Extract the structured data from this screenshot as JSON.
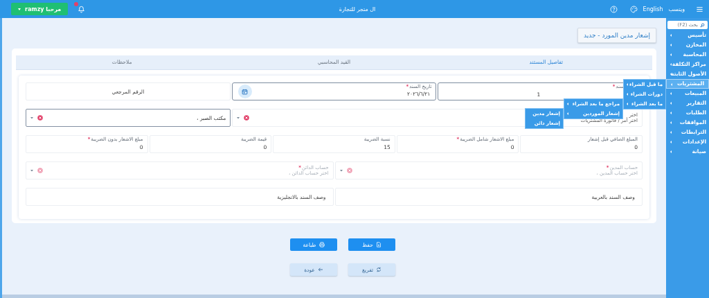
{
  "top_bar": {
    "user_button": "ramzy مرحبا",
    "store_name": "ال متجر للتجارة",
    "language": "English",
    "label": "ويتسب"
  },
  "sidebar": {
    "search_placeholder": "بحث (F2)",
    "items": [
      {
        "label": "تأسيس",
        "selected": false
      },
      {
        "label": "المخازن",
        "selected": false
      },
      {
        "label": "المحاسبة",
        "selected": false
      },
      {
        "label": "مراكز التكلفة",
        "selected": false
      },
      {
        "label": "الأصول الثابتة",
        "selected": false
      },
      {
        "label": "المشتريات",
        "selected": true,
        "children": [
          {
            "label": "ما قبل الشراء"
          },
          {
            "label": "دورات الشراء"
          },
          {
            "label": "ما بعد الشراء",
            "children": [
              {
                "label": "مراجع ما بعد الشراء"
              },
              {
                "label": "إشعار الموردين",
                "children": [
                  {
                    "label": "إشعار مدين"
                  },
                  {
                    "label": "إشعار دائن"
                  }
                ]
              }
            ]
          }
        ]
      },
      {
        "label": "المبيعات",
        "selected": false
      },
      {
        "label": "التقارير",
        "selected": false
      },
      {
        "label": "الطلبات",
        "selected": false
      },
      {
        "label": "الموافقات",
        "selected": false
      },
      {
        "label": "الترابطات",
        "selected": false
      },
      {
        "label": "الإعدادات",
        "selected": false
      },
      {
        "label": "صيانة",
        "selected": false
      }
    ]
  },
  "page_title": "إشعار مدين المورد - جديد",
  "tabs": [
    {
      "label": "تفاصيل المستند",
      "selected": true
    },
    {
      "label": "القيد المحاسبي",
      "selected": false
    },
    {
      "label": "ملاحظات",
      "selected": false
    }
  ],
  "form_rows": [
    [
      {
        "kind": "text",
        "label": "سند",
        "required_mark": "*",
        "value": "1"
      },
      {
        "kind": "date",
        "label": "تاريخ السند",
        "required_mark": "*",
        "value": "٢٠٢٦/٦/٢١"
      },
      {
        "kind": "text",
        "placeholder": "الرقم المرجعي"
      }
    ],
    [
      {
        "kind": "select",
        "label": "اختر",
        "placeholder": "اختر أمر / فاتورة المشتريات",
        "disabled": false,
        "focused": false
      },
      {
        "kind": "select",
        "value": "مكتب الصبر ،",
        "disabled": false,
        "focused": true
      }
    ],
    [
      {
        "kind": "text",
        "label": "المبلغ الصافي قبل إشعار",
        "value": "0"
      },
      {
        "kind": "text",
        "label": "مبلغ الاشعار شامل الضريبة",
        "required_mark": "*",
        "value": "0"
      },
      {
        "kind": "text",
        "label": "نسبة الضريبة",
        "value": "15"
      },
      {
        "kind": "text",
        "label": "قيمة الضريبة",
        "value": "0"
      },
      {
        "kind": "text",
        "label": "مبلغ الاشعار بدون الضريبة",
        "required_mark": "*",
        "value": "0"
      }
    ],
    [
      {
        "kind": "select",
        "label": "حساب المدين",
        "required_mark": "*",
        "placeholder": "اختر حساب المدين ،",
        "disabled": true,
        "focused": false
      },
      {
        "kind": "select",
        "label": "حساب الدائن",
        "required_mark": "*",
        "placeholder": "اختر حساب الدائن ،",
        "disabled": true,
        "focused": false
      }
    ],
    [
      {
        "kind": "textarea",
        "placeholder": "وصف السند بالعربية"
      },
      {
        "kind": "textarea",
        "placeholder": "وصف السند بالانجليزية"
      }
    ]
  ],
  "buttons": [
    [
      {
        "kind": "save",
        "label": "حفظ",
        "primary": true
      },
      {
        "kind": "print",
        "label": "طباعة",
        "primary": true
      }
    ],
    [
      {
        "kind": "reset",
        "label": "تفريغ",
        "primary": false
      },
      {
        "kind": "back",
        "label": "عودة",
        "primary": false
      }
    ]
  ]
}
